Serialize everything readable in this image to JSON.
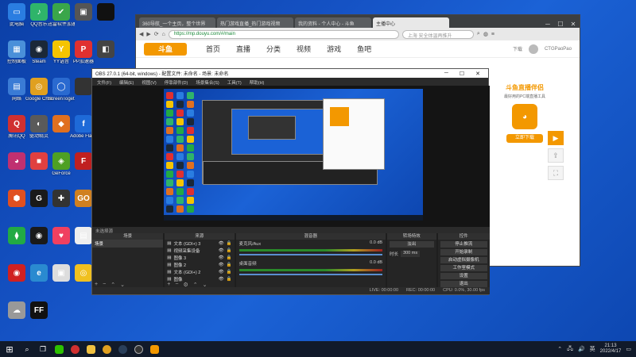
{
  "desktop": {
    "icons": [
      {
        "label": "此电脑",
        "color": "#2a7de1",
        "glyph": "▭"
      },
      {
        "label": "QQ音乐",
        "color": "#2fb46a",
        "glyph": "♪"
      },
      {
        "label": "迅雷软件加速器",
        "color": "#3aa64a",
        "glyph": "✔"
      },
      {
        "label": "",
        "color": "#555",
        "glyph": "▣"
      },
      {
        "label": "",
        "color": "#111",
        "glyph": ""
      },
      {
        "label": "控制面板",
        "color": "#4a90d9",
        "glyph": "▦"
      },
      {
        "label": "Steam",
        "color": "#1b2838",
        "glyph": "◉"
      },
      {
        "label": "YY语音",
        "color": "#f5c400",
        "glyph": "Y"
      },
      {
        "label": "PP加速器",
        "color": "#e03030",
        "glyph": "P"
      },
      {
        "label": "",
        "color": "#444",
        "glyph": "◧"
      },
      {
        "label": "网络",
        "color": "#3a7bd5",
        "glyph": "▤"
      },
      {
        "label": "Google Chrome",
        "color": "#e0a020",
        "glyph": "◎"
      },
      {
        "label": "ScreenTogether",
        "color": "#2a6ad0",
        "glyph": "◯"
      },
      {
        "label": "",
        "color": "#333",
        "glyph": ""
      },
      {
        "label": "回收站",
        "color": "#5d8fd0",
        "glyph": "♻"
      },
      {
        "label": "腾讯QQ",
        "color": "#d03030",
        "glyph": "Q"
      },
      {
        "label": "驱动精灵",
        "color": "#5a5a5a",
        "glyph": "◐"
      },
      {
        "label": "",
        "color": "#e07020",
        "glyph": "◆"
      },
      {
        "label": "Adobe Flash",
        "color": "#1e6ad8",
        "glyph": "f"
      },
      {
        "label": "腾讯QQ",
        "color": "#111",
        "glyph": "◑"
      },
      {
        "label": "",
        "color": "#c03070",
        "glyph": "◕"
      },
      {
        "label": "",
        "color": "#e04040",
        "glyph": "■"
      },
      {
        "label": "GeForce",
        "color": "#4ea024",
        "glyph": "◈"
      },
      {
        "label": "",
        "color": "#c02020",
        "glyph": "F"
      },
      {
        "label": "",
        "color": "#e04040",
        "glyph": "F"
      },
      {
        "label": "",
        "color": "#e05020",
        "glyph": "⬢"
      },
      {
        "label": "",
        "color": "#1a1a1a",
        "glyph": "G"
      },
      {
        "label": "",
        "color": "#333",
        "glyph": "✚"
      },
      {
        "label": "",
        "color": "#d08020",
        "glyph": "GO"
      },
      {
        "label": "",
        "color": "#444",
        "glyph": "▣"
      },
      {
        "label": "",
        "color": "#22aa44",
        "glyph": "⧫"
      },
      {
        "label": "",
        "color": "#1a1a1a",
        "glyph": "◉"
      },
      {
        "label": "",
        "color": "#f04060",
        "glyph": "♥"
      },
      {
        "label": "",
        "color": "#eee",
        "glyph": "▤"
      },
      {
        "label": "",
        "color": "#222",
        "glyph": "◎"
      },
      {
        "label": "",
        "color": "#d02020",
        "glyph": "◉"
      },
      {
        "label": "",
        "color": "#2a8ad0",
        "glyph": "e"
      },
      {
        "label": "",
        "color": "#ddd",
        "glyph": "▣"
      },
      {
        "label": "",
        "color": "#f0c020",
        "glyph": "◎"
      },
      {
        "label": "",
        "color": "#ddd",
        "glyph": "◔"
      },
      {
        "label": "",
        "color": "#999",
        "glyph": "☁"
      },
      {
        "label": "",
        "color": "#111",
        "glyph": "FF"
      }
    ]
  },
  "browser": {
    "tabs": [
      "360导航_一个主页，整个世界",
      "热门游戏直播_热门游戏视频",
      "我的资料 - 个人中心 - 斗鱼",
      "主播中心"
    ],
    "active_tab": 3,
    "url": "https://mp.douyu.com/#/main",
    "search_placeholder": "上海 安全体温再推升",
    "logo": "斗鱼",
    "nav": [
      "首页",
      "直播",
      "分类",
      "视频",
      "游戏",
      "鱼吧"
    ],
    "right": {
      "download": "下载",
      "user": "CTGPaoPao"
    },
    "promo": {
      "title": "斗鱼直播伴侣",
      "subtitle": "最好用的PC端直播工具",
      "icon": "douyu",
      "button": "立即下载"
    }
  },
  "obs": {
    "title": "OBS 27.0.1 (64-bit, windows) - 配置文件: 未命名 - 场景: 未命名",
    "menu": [
      "文件(F)",
      "编辑(E)",
      "视图(V)",
      "停靠部件(D)",
      "场景集合(S)",
      "工具(T)",
      "帮助(H)"
    ],
    "status_bar_text": "未选择源",
    "docks": {
      "scenes": {
        "header": "场景",
        "items": [
          "场景"
        ]
      },
      "sources": {
        "header": "来源",
        "items": [
          "文本 (GDI+) 3",
          "视频采集设备",
          "图像 3",
          "图像 2",
          "文本 (GDI+) 2",
          "图像"
        ]
      },
      "mixer": {
        "header": "混音器",
        "tracks": [
          {
            "name": "麦克风/Aux",
            "db": "0.0 dB"
          },
          {
            "name": "桌面音频",
            "db": "0.0 dB"
          }
        ]
      },
      "transitions": {
        "header": "转场特效",
        "type": "淡出",
        "duration_label": "时长",
        "duration": "300 ms"
      },
      "controls": {
        "header": "控件",
        "buttons": [
          "停止推流",
          "开始录制",
          "启动虚拟摄像机",
          "工作室模式",
          "设置",
          "退出"
        ]
      }
    },
    "status": {
      "live": "LIVE: 00:00:00",
      "rec": "REC: 00:00:00",
      "cpu": "CPU: 0.0%, 30.00 fps"
    }
  },
  "taskbar": {
    "time": "21:13",
    "date": "2022/4/17",
    "ime": "英"
  }
}
